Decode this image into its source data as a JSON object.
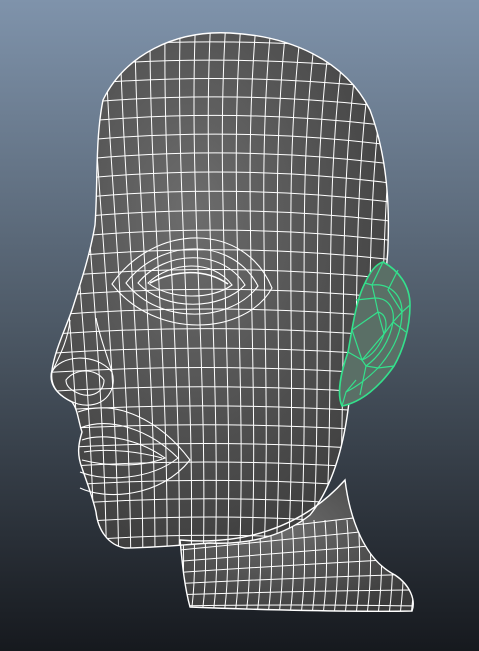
{
  "viewport": {
    "background_top": "#7f93ab",
    "background_mid": "#4d5966",
    "background_bottom": "#16191e"
  },
  "model": {
    "fill_color": "#6d6d6d",
    "shade_color": "#3a3a3a",
    "wire_color": "#ffffff",
    "selection_color": "#34e08c",
    "selection_fill": "#5a6f66"
  }
}
